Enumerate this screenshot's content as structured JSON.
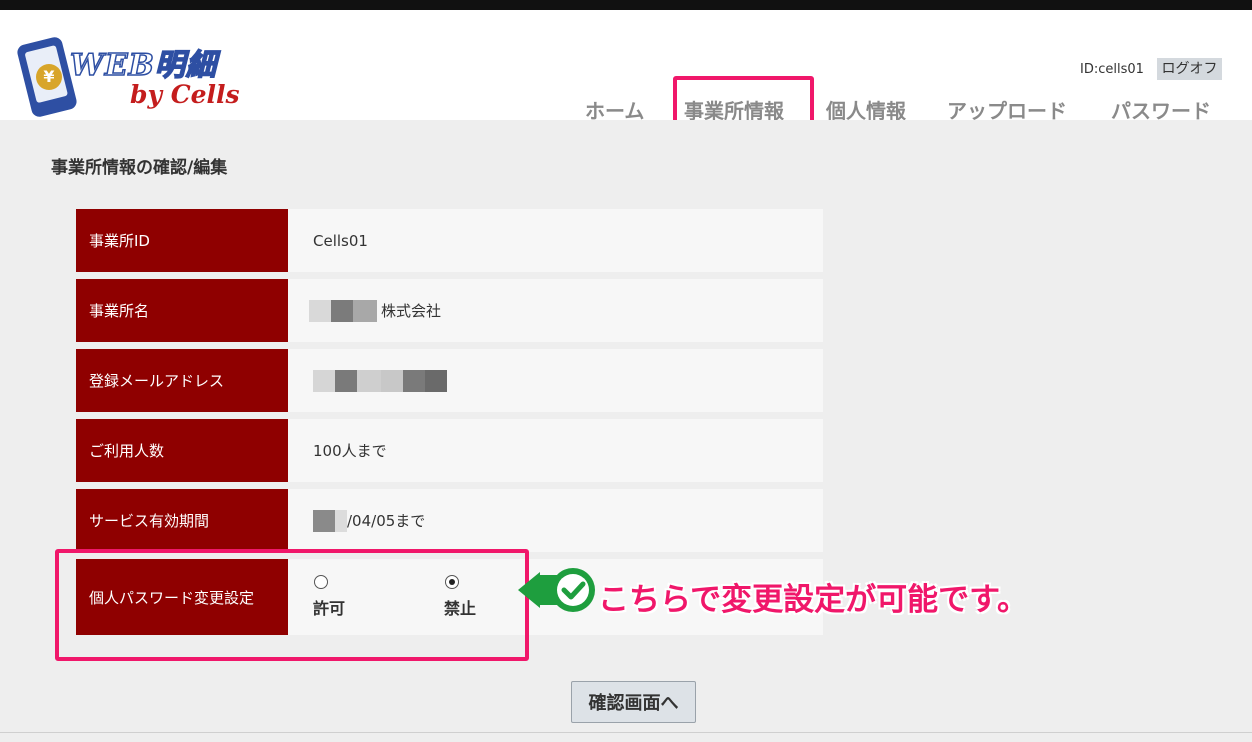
{
  "header": {
    "logo": {
      "title": "WEB明細",
      "subtitle": "by Cells",
      "yen_symbol": "¥"
    },
    "user_id": "ID:cells01",
    "logoff_label": "ログオフ",
    "nav": [
      {
        "label": "ホーム"
      },
      {
        "label": "事業所情報",
        "active": true
      },
      {
        "label": "個人情報"
      },
      {
        "label": "アップロード"
      },
      {
        "label": "パスワード"
      }
    ]
  },
  "page": {
    "title": "事業所情報の確認/編集"
  },
  "rows": [
    {
      "label": "事業所ID",
      "value": "Cells01"
    },
    {
      "label": "事業所名",
      "value_suffix": "株式会社"
    },
    {
      "label": "登録メールアドレス"
    },
    {
      "label": "ご利用人数",
      "value": "100人まで"
    },
    {
      "label": "サービス有効期間",
      "value_suffix": "/04/05まで"
    },
    {
      "label": "個人パスワード変更設定"
    }
  ],
  "password_setting": {
    "options": [
      {
        "label": "許可",
        "checked": false
      },
      {
        "label": "禁止",
        "checked": true
      }
    ]
  },
  "callout": {
    "text": "こちらで変更設定が可能です。"
  },
  "confirm_button": "確認画面へ",
  "colors": {
    "label_bg": "#8f0000",
    "highlight": "#f0176a",
    "callout_green": "#1e9e3e",
    "page_bg": "#eeeeee"
  }
}
